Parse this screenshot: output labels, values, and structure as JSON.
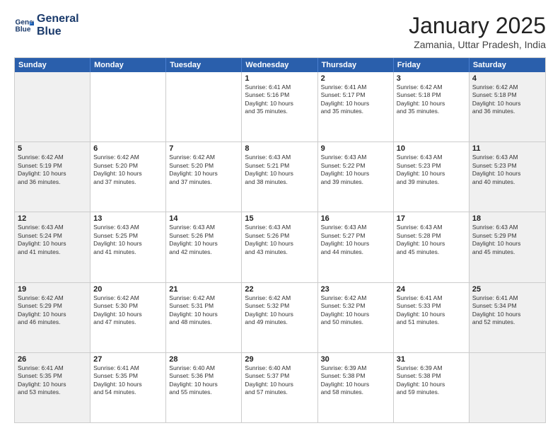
{
  "logo": {
    "line1": "General",
    "line2": "Blue"
  },
  "title": "January 2025",
  "subtitle": "Zamania, Uttar Pradesh, India",
  "days_header": [
    "Sunday",
    "Monday",
    "Tuesday",
    "Wednesday",
    "Thursday",
    "Friday",
    "Saturday"
  ],
  "weeks": [
    [
      {
        "day": "",
        "info": ""
      },
      {
        "day": "",
        "info": ""
      },
      {
        "day": "",
        "info": ""
      },
      {
        "day": "1",
        "info": "Sunrise: 6:41 AM\nSunset: 5:16 PM\nDaylight: 10 hours\nand 35 minutes."
      },
      {
        "day": "2",
        "info": "Sunrise: 6:41 AM\nSunset: 5:17 PM\nDaylight: 10 hours\nand 35 minutes."
      },
      {
        "day": "3",
        "info": "Sunrise: 6:42 AM\nSunset: 5:18 PM\nDaylight: 10 hours\nand 35 minutes."
      },
      {
        "day": "4",
        "info": "Sunrise: 6:42 AM\nSunset: 5:18 PM\nDaylight: 10 hours\nand 36 minutes."
      }
    ],
    [
      {
        "day": "5",
        "info": "Sunrise: 6:42 AM\nSunset: 5:19 PM\nDaylight: 10 hours\nand 36 minutes."
      },
      {
        "day": "6",
        "info": "Sunrise: 6:42 AM\nSunset: 5:20 PM\nDaylight: 10 hours\nand 37 minutes."
      },
      {
        "day": "7",
        "info": "Sunrise: 6:42 AM\nSunset: 5:20 PM\nDaylight: 10 hours\nand 37 minutes."
      },
      {
        "day": "8",
        "info": "Sunrise: 6:43 AM\nSunset: 5:21 PM\nDaylight: 10 hours\nand 38 minutes."
      },
      {
        "day": "9",
        "info": "Sunrise: 6:43 AM\nSunset: 5:22 PM\nDaylight: 10 hours\nand 39 minutes."
      },
      {
        "day": "10",
        "info": "Sunrise: 6:43 AM\nSunset: 5:23 PM\nDaylight: 10 hours\nand 39 minutes."
      },
      {
        "day": "11",
        "info": "Sunrise: 6:43 AM\nSunset: 5:23 PM\nDaylight: 10 hours\nand 40 minutes."
      }
    ],
    [
      {
        "day": "12",
        "info": "Sunrise: 6:43 AM\nSunset: 5:24 PM\nDaylight: 10 hours\nand 41 minutes."
      },
      {
        "day": "13",
        "info": "Sunrise: 6:43 AM\nSunset: 5:25 PM\nDaylight: 10 hours\nand 41 minutes."
      },
      {
        "day": "14",
        "info": "Sunrise: 6:43 AM\nSunset: 5:26 PM\nDaylight: 10 hours\nand 42 minutes."
      },
      {
        "day": "15",
        "info": "Sunrise: 6:43 AM\nSunset: 5:26 PM\nDaylight: 10 hours\nand 43 minutes."
      },
      {
        "day": "16",
        "info": "Sunrise: 6:43 AM\nSunset: 5:27 PM\nDaylight: 10 hours\nand 44 minutes."
      },
      {
        "day": "17",
        "info": "Sunrise: 6:43 AM\nSunset: 5:28 PM\nDaylight: 10 hours\nand 45 minutes."
      },
      {
        "day": "18",
        "info": "Sunrise: 6:43 AM\nSunset: 5:29 PM\nDaylight: 10 hours\nand 45 minutes."
      }
    ],
    [
      {
        "day": "19",
        "info": "Sunrise: 6:42 AM\nSunset: 5:29 PM\nDaylight: 10 hours\nand 46 minutes."
      },
      {
        "day": "20",
        "info": "Sunrise: 6:42 AM\nSunset: 5:30 PM\nDaylight: 10 hours\nand 47 minutes."
      },
      {
        "day": "21",
        "info": "Sunrise: 6:42 AM\nSunset: 5:31 PM\nDaylight: 10 hours\nand 48 minutes."
      },
      {
        "day": "22",
        "info": "Sunrise: 6:42 AM\nSunset: 5:32 PM\nDaylight: 10 hours\nand 49 minutes."
      },
      {
        "day": "23",
        "info": "Sunrise: 6:42 AM\nSunset: 5:32 PM\nDaylight: 10 hours\nand 50 minutes."
      },
      {
        "day": "24",
        "info": "Sunrise: 6:41 AM\nSunset: 5:33 PM\nDaylight: 10 hours\nand 51 minutes."
      },
      {
        "day": "25",
        "info": "Sunrise: 6:41 AM\nSunset: 5:34 PM\nDaylight: 10 hours\nand 52 minutes."
      }
    ],
    [
      {
        "day": "26",
        "info": "Sunrise: 6:41 AM\nSunset: 5:35 PM\nDaylight: 10 hours\nand 53 minutes."
      },
      {
        "day": "27",
        "info": "Sunrise: 6:41 AM\nSunset: 5:35 PM\nDaylight: 10 hours\nand 54 minutes."
      },
      {
        "day": "28",
        "info": "Sunrise: 6:40 AM\nSunset: 5:36 PM\nDaylight: 10 hours\nand 55 minutes."
      },
      {
        "day": "29",
        "info": "Sunrise: 6:40 AM\nSunset: 5:37 PM\nDaylight: 10 hours\nand 57 minutes."
      },
      {
        "day": "30",
        "info": "Sunrise: 6:39 AM\nSunset: 5:38 PM\nDaylight: 10 hours\nand 58 minutes."
      },
      {
        "day": "31",
        "info": "Sunrise: 6:39 AM\nSunset: 5:38 PM\nDaylight: 10 hours\nand 59 minutes."
      },
      {
        "day": "",
        "info": ""
      }
    ]
  ]
}
